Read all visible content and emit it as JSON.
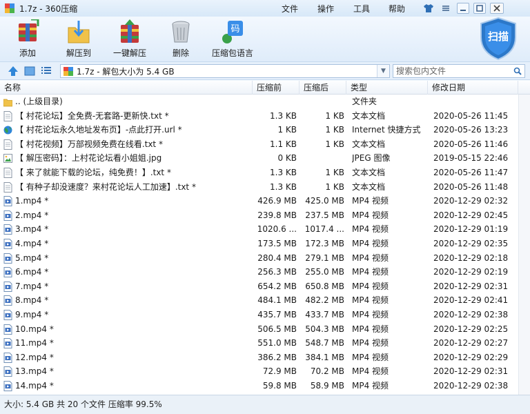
{
  "window": {
    "title": "1.7z - 360压缩"
  },
  "menu": {
    "file": "文件",
    "operate": "操作",
    "tools": "工具",
    "help": "帮助"
  },
  "toolbar": {
    "add": "添加",
    "extract_to": "解压到",
    "one_click_extract": "一键解压",
    "delete": "删除",
    "language": "压缩包语言",
    "language_icon_text": "码",
    "scan": "扫描"
  },
  "address": {
    "path": "1.7z - 解包大小为 5.4 GB"
  },
  "search": {
    "placeholder": "搜索包内文件"
  },
  "columns": {
    "name": "名称",
    "orig": "压缩前",
    "comp": "压缩后",
    "type": "类型",
    "date": "修改日期"
  },
  "rows": [
    {
      "icon": "folder-up-icon",
      "name": ".. (上级目录)",
      "orig": "",
      "comp": "",
      "type": "文件夹",
      "date": ""
    },
    {
      "icon": "text-file-icon",
      "name": "【 村花论坛】全免费-无套路-更新快.txt *",
      "orig": "1.3 KB",
      "comp": "1 KB",
      "type": "文本文档",
      "date": "2020-05-26 11:45"
    },
    {
      "icon": "globe-icon",
      "name": "【 村花论坛永久地址发布页】-点此打开.url *",
      "orig": "1 KB",
      "comp": "1 KB",
      "type": "Internet 快捷方式",
      "date": "2020-05-26 13:23"
    },
    {
      "icon": "text-file-icon",
      "name": "【 村花视频】万部视频免费在线看.txt *",
      "orig": "1.1 KB",
      "comp": "1 KB",
      "type": "文本文档",
      "date": "2020-05-26 11:46"
    },
    {
      "icon": "image-file-icon",
      "name": "【 解压密码】：上村花论坛看小姐姐.jpg",
      "orig": "0 KB",
      "comp": "",
      "type": "JPEG 图像",
      "date": "2019-05-15 22:46"
    },
    {
      "icon": "text-file-icon",
      "name": "【 来了就能下载的论坛，纯免费！】.txt *",
      "orig": "1.3 KB",
      "comp": "1 KB",
      "type": "文本文档",
      "date": "2020-05-26 11:47"
    },
    {
      "icon": "text-file-icon",
      "name": "【 有种子却没速度？来村花论坛人工加速】.txt *",
      "orig": "1.3 KB",
      "comp": "1 KB",
      "type": "文本文档",
      "date": "2020-05-26 11:48"
    },
    {
      "icon": "video-file-icon",
      "name": "1.mp4 *",
      "orig": "426.9 MB",
      "comp": "425.0 MB",
      "type": "MP4 视频",
      "date": "2020-12-29 02:32"
    },
    {
      "icon": "video-file-icon",
      "name": "2.mp4 *",
      "orig": "239.8 MB",
      "comp": "237.5 MB",
      "type": "MP4 视频",
      "date": "2020-12-29 02:45"
    },
    {
      "icon": "video-file-icon",
      "name": "3.mp4 *",
      "orig": "1020.6 ...",
      "comp": "1017.4 ...",
      "type": "MP4 视频",
      "date": "2020-12-29 01:19"
    },
    {
      "icon": "video-file-icon",
      "name": "4.mp4 *",
      "orig": "173.5 MB",
      "comp": "172.3 MB",
      "type": "MP4 视频",
      "date": "2020-12-29 02:35"
    },
    {
      "icon": "video-file-icon",
      "name": "5.mp4 *",
      "orig": "280.4 MB",
      "comp": "279.1 MB",
      "type": "MP4 视频",
      "date": "2020-12-29 02:18"
    },
    {
      "icon": "video-file-icon",
      "name": "6.mp4 *",
      "orig": "256.3 MB",
      "comp": "255.0 MB",
      "type": "MP4 视频",
      "date": "2020-12-29 02:19"
    },
    {
      "icon": "video-file-icon",
      "name": "7.mp4 *",
      "orig": "654.2 MB",
      "comp": "650.8 MB",
      "type": "MP4 视频",
      "date": "2020-12-29 02:31"
    },
    {
      "icon": "video-file-icon",
      "name": "8.mp4 *",
      "orig": "484.1 MB",
      "comp": "482.2 MB",
      "type": "MP4 视频",
      "date": "2020-12-29 02:41"
    },
    {
      "icon": "video-file-icon",
      "name": "9.mp4 *",
      "orig": "435.7 MB",
      "comp": "433.7 MB",
      "type": "MP4 视频",
      "date": "2020-12-29 02:38"
    },
    {
      "icon": "video-file-icon",
      "name": "10.mp4 *",
      "orig": "506.5 MB",
      "comp": "504.3 MB",
      "type": "MP4 视频",
      "date": "2020-12-29 02:25"
    },
    {
      "icon": "video-file-icon",
      "name": "11.mp4 *",
      "orig": "551.0 MB",
      "comp": "548.7 MB",
      "type": "MP4 视频",
      "date": "2020-12-29 02:27"
    },
    {
      "icon": "video-file-icon",
      "name": "12.mp4 *",
      "orig": "386.2 MB",
      "comp": "384.1 MB",
      "type": "MP4 视频",
      "date": "2020-12-29 02:29"
    },
    {
      "icon": "video-file-icon",
      "name": "13.mp4 *",
      "orig": "72.9 MB",
      "comp": "70.2 MB",
      "type": "MP4 视频",
      "date": "2020-12-29 02:31"
    },
    {
      "icon": "video-file-icon",
      "name": "14.mp4 *",
      "orig": "59.8 MB",
      "comp": "58.9 MB",
      "type": "MP4 视频",
      "date": "2020-12-29 02:38"
    }
  ],
  "status": {
    "text": "大小: 5.4 GB 共 20 个文件 压缩率 99.5%"
  },
  "colors": {
    "accent": "#2f6fb5",
    "folder": "#f0c24a",
    "scan_shield": "#2c78c9"
  }
}
